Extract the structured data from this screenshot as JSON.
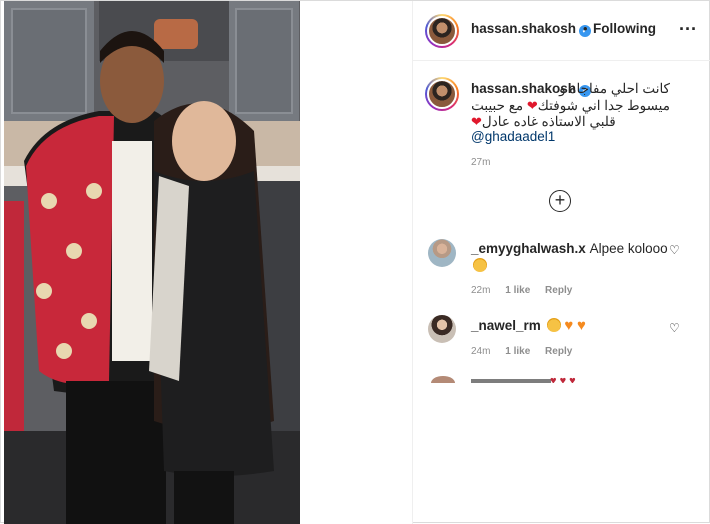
{
  "post": {
    "author": {
      "username": "hassan.shakosh",
      "verified_icon": "verified-badge-icon",
      "follow_status": "Following"
    },
    "caption": {
      "line1": "كانت احلي مفاجاه و",
      "line2_a": "ميسوط جدا اني شوفتك",
      "line2_b": "مع حبيبت",
      "line3": "قلبي الاستاذه غاده عادل",
      "mention": "@ghadaadel1",
      "time": "27m"
    },
    "load_more_icon": "plus-circle-icon",
    "comments": [
      {
        "username": "_emyyghalwash.x",
        "text": "Alpee kolooo",
        "time": "22m",
        "likes": "1 like",
        "reply": "Reply"
      },
      {
        "username": "_nawel_rm",
        "text": "",
        "time": "24m",
        "likes": "1 like",
        "reply": "Reply"
      }
    ]
  },
  "colors": {
    "verified": "#3897f0",
    "heart_red": "#e0182d",
    "mention": "#00376b",
    "muted": "#8e8e8e"
  }
}
